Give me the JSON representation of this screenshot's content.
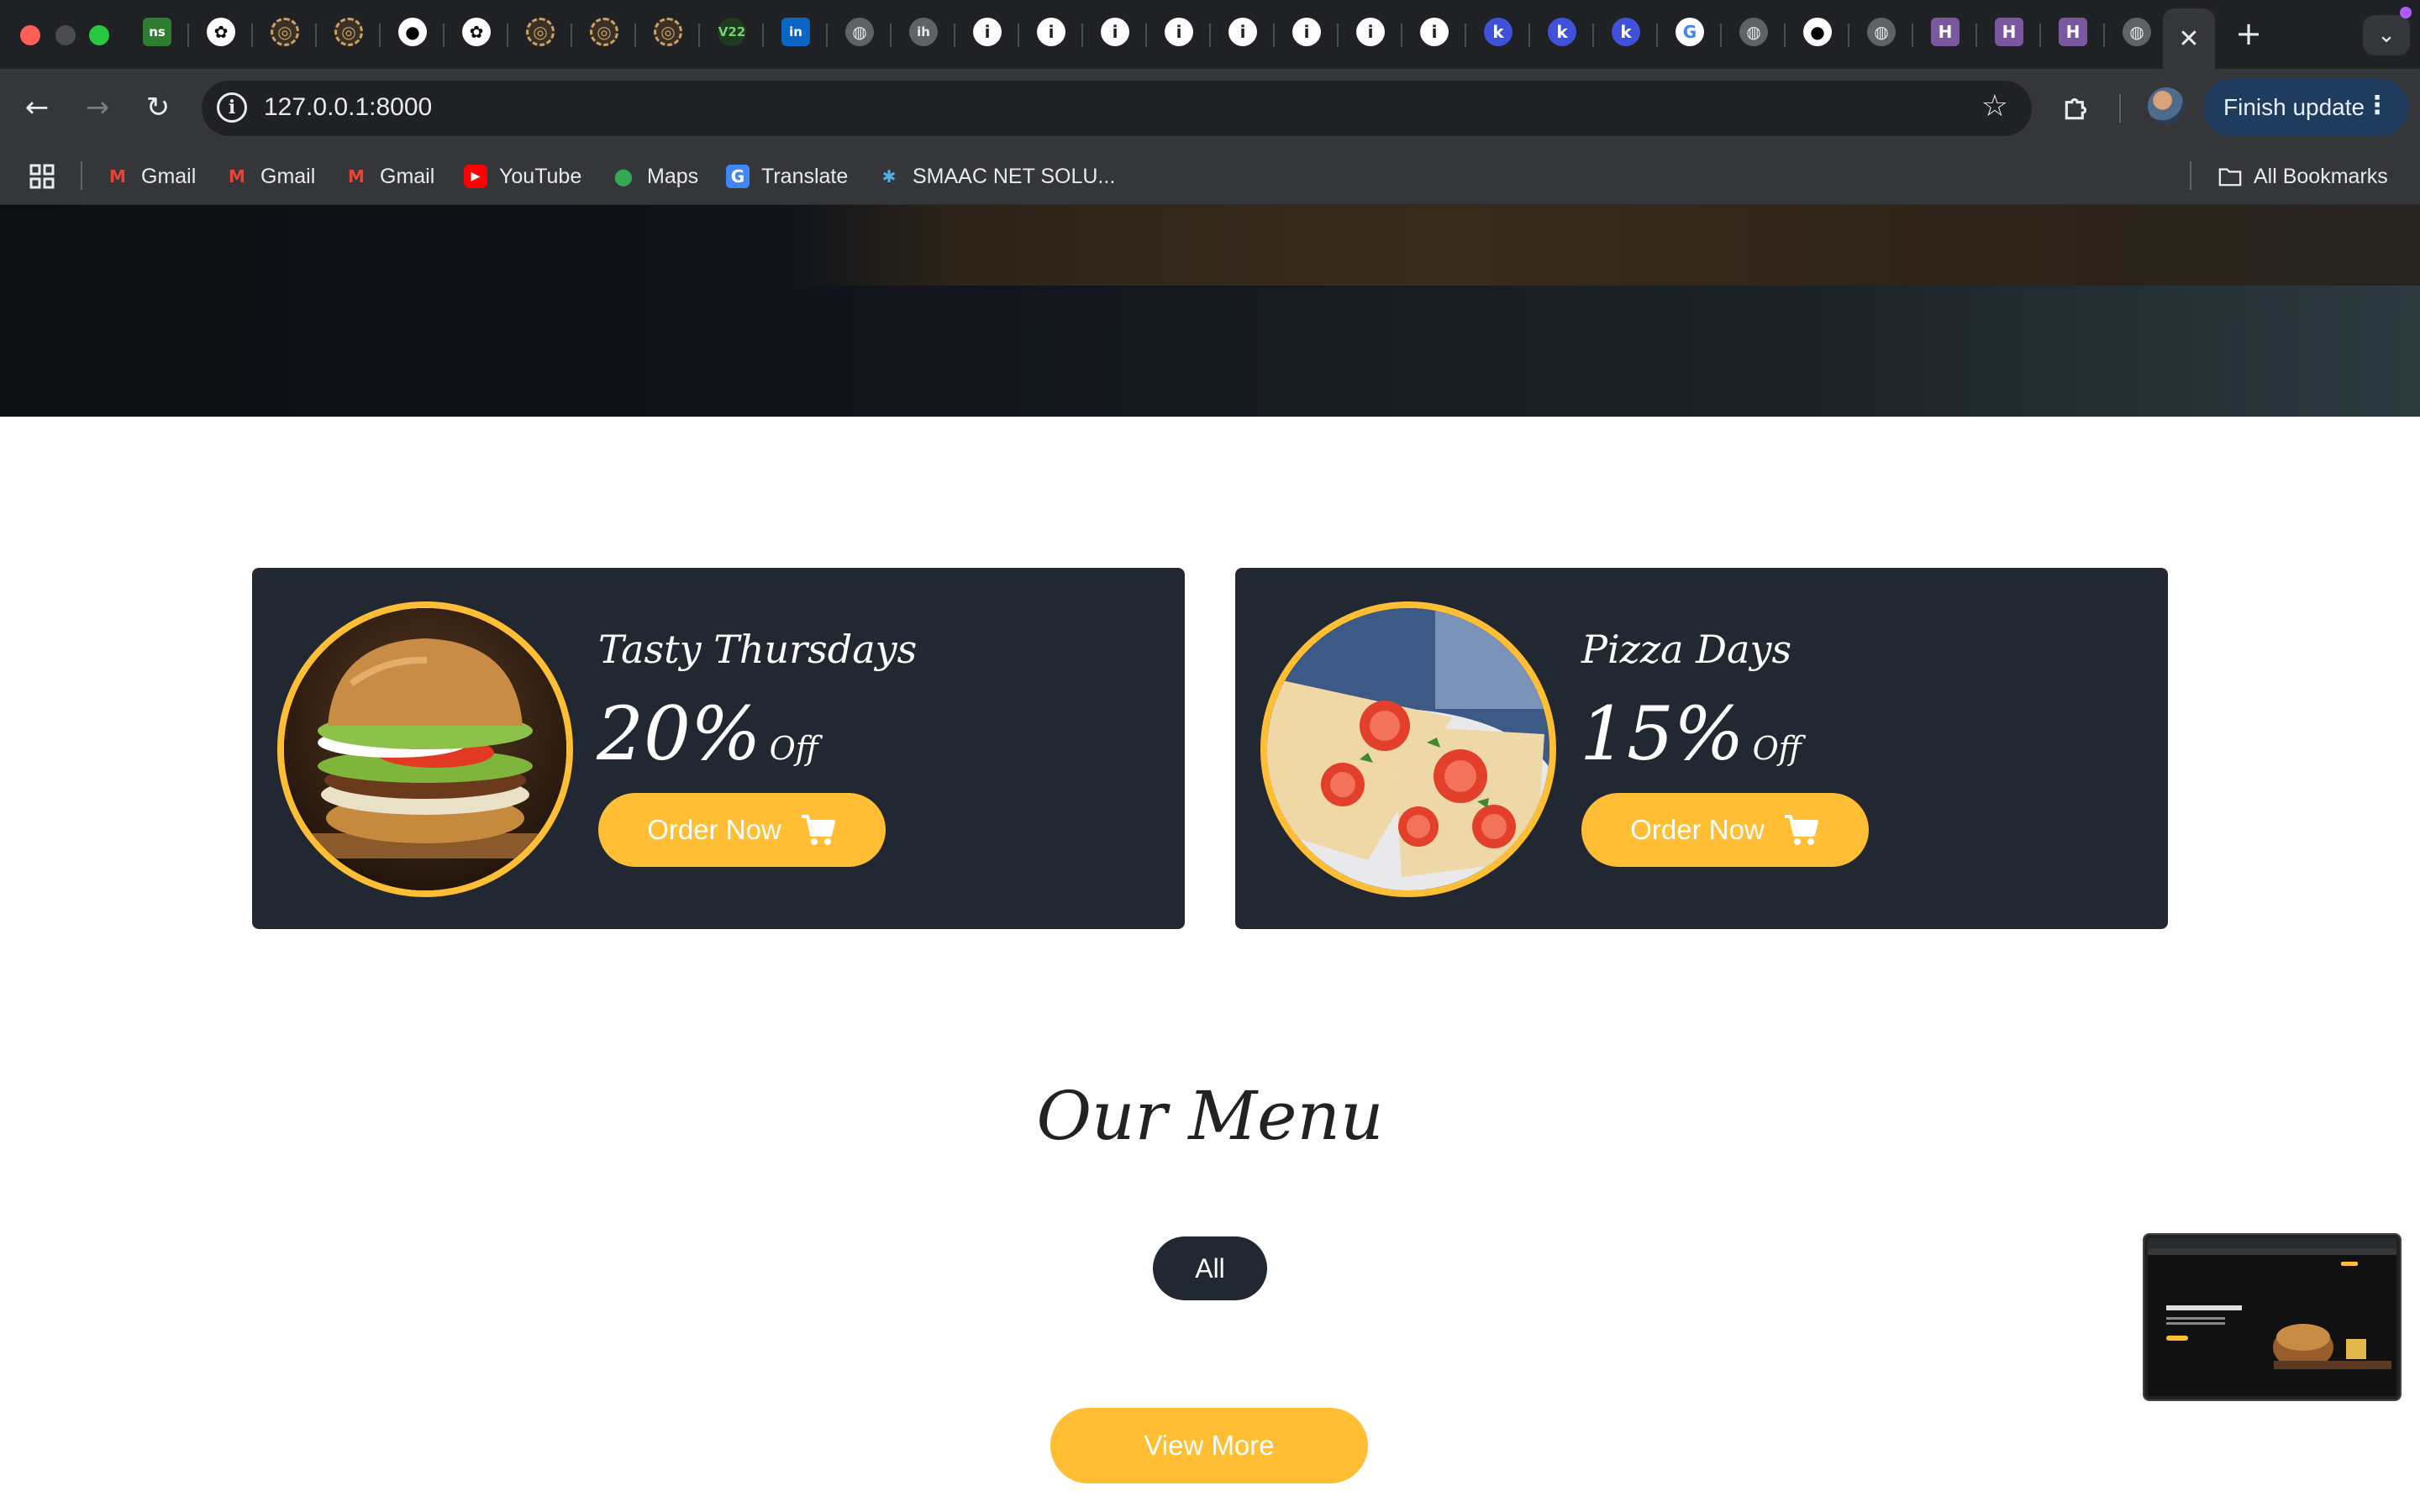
{
  "browser": {
    "tabs": [
      {
        "icon": "ns-icon",
        "label": "ns",
        "bg": "#2e7d32"
      },
      {
        "icon": "openai-icon"
      },
      {
        "icon": "gold-seal-icon"
      },
      {
        "icon": "gold-seal-icon"
      },
      {
        "icon": "github-icon"
      },
      {
        "icon": "openai-icon"
      },
      {
        "icon": "gold-seal-icon"
      },
      {
        "icon": "gold-seal-icon"
      },
      {
        "icon": "gold-seal-icon"
      },
      {
        "icon": "v22-icon",
        "label": "V22"
      },
      {
        "icon": "linkedin-icon",
        "label": "in"
      },
      {
        "icon": "globe-icon"
      },
      {
        "icon": "ih-icon",
        "label": "ih"
      },
      {
        "icon": "info-icon",
        "label": "i"
      },
      {
        "icon": "info-icon",
        "label": "i"
      },
      {
        "icon": "info-icon",
        "label": "i"
      },
      {
        "icon": "info-icon",
        "label": "i"
      },
      {
        "icon": "info-icon",
        "label": "i"
      },
      {
        "icon": "info-icon",
        "label": "i"
      },
      {
        "icon": "info-icon",
        "label": "i"
      },
      {
        "icon": "info-icon",
        "label": "i"
      },
      {
        "icon": "k-icon",
        "label": "k"
      },
      {
        "icon": "k-icon",
        "label": "k"
      },
      {
        "icon": "k-icon",
        "label": "k"
      },
      {
        "icon": "google-icon",
        "label": "G"
      },
      {
        "icon": "globe-icon"
      },
      {
        "icon": "github-icon"
      },
      {
        "icon": "globe-icon"
      },
      {
        "icon": "heroku-icon",
        "label": "H"
      },
      {
        "icon": "heroku-icon",
        "label": "H"
      },
      {
        "icon": "heroku-icon",
        "label": "H"
      },
      {
        "icon": "globe-icon"
      }
    ],
    "active_tab_close": "✕",
    "new_tab": "+",
    "tab_menu": "⌄",
    "url": "127.0.0.1:8000",
    "finish_update": "Finish update",
    "bookmarks": [
      {
        "label": "Gmail",
        "icon": "gmail-icon"
      },
      {
        "label": "Gmail",
        "icon": "gmail-icon"
      },
      {
        "label": "Gmail",
        "icon": "gmail-icon"
      },
      {
        "label": "YouTube",
        "icon": "youtube-icon"
      },
      {
        "label": "Maps",
        "icon": "maps-icon"
      },
      {
        "label": "Translate",
        "icon": "translate-icon"
      },
      {
        "label": "SMAAC NET SOLU...",
        "icon": "smaac-icon"
      }
    ],
    "all_bookmarks": "All Bookmarks"
  },
  "page": {
    "offers": [
      {
        "title": "Tasty Thursdays",
        "percent": "20%",
        "off": "Off",
        "button": "Order Now",
        "image": "burger"
      },
      {
        "title": "Pizza Days",
        "percent": "15%",
        "off": "Off",
        "button": "Order Now",
        "image": "pizza"
      }
    ],
    "menu_heading": "Our Menu",
    "filter_all": "All",
    "view_more": "View More"
  },
  "colors": {
    "accent": "#ffbe33",
    "card_bg": "#222831",
    "chrome_dark": "#202124",
    "chrome_toolbar": "#35363a"
  }
}
